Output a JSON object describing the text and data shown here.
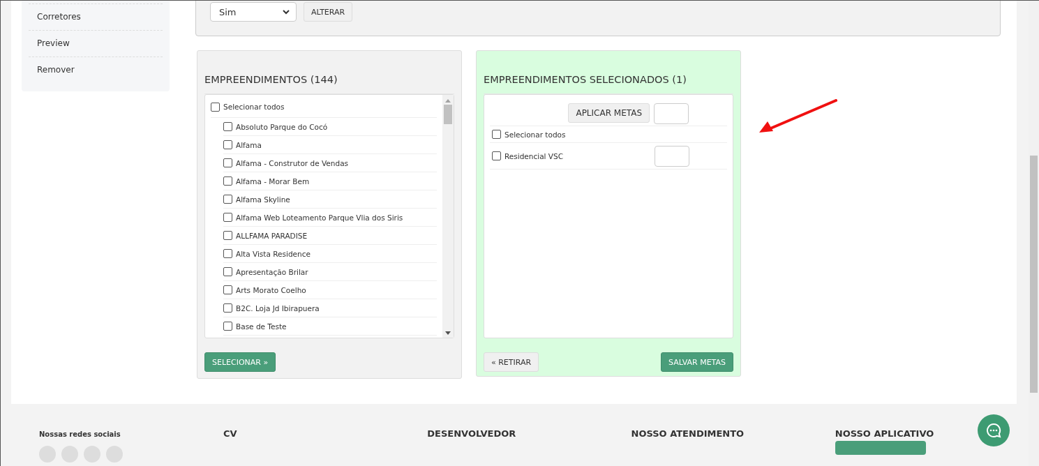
{
  "sidebar": {
    "items": [
      {
        "label": "Corretores"
      },
      {
        "label": "Preview"
      },
      {
        "label": "Remover"
      }
    ]
  },
  "top_panel": {
    "select": {
      "value": "Sim"
    },
    "button": "ALTERAR"
  },
  "available": {
    "title": "EMPREENDIMENTOS (144)",
    "select_all": {
      "label": "Selecionar todos",
      "checked": false
    },
    "items": [
      {
        "label": "Absoluto Parque do Cocó",
        "checked": false
      },
      {
        "label": "Alfama",
        "checked": false
      },
      {
        "label": "Alfama - Construtor de Vendas",
        "checked": false
      },
      {
        "label": "Alfama - Morar Bem",
        "checked": false
      },
      {
        "label": "Alfama Skyline",
        "checked": false
      },
      {
        "label": "Alfama Web Loteamento Parque Vlia dos Siris",
        "checked": false
      },
      {
        "label": "ALLFAMA PARADISE",
        "checked": false
      },
      {
        "label": "Alta Vista Residence",
        "checked": false
      },
      {
        "label": "Apresentação Brilar",
        "checked": false
      },
      {
        "label": "Arts Morato Coelho",
        "checked": false
      },
      {
        "label": "B2C. Loja Jd Ibirapuera",
        "checked": false
      },
      {
        "label": "Base de Teste",
        "checked": false
      }
    ],
    "button": "SELECIONAR »"
  },
  "selected": {
    "title": "EMPREENDIMENTOS SELECIONADOS (1)",
    "apply_button": "APLICAR METAS",
    "select_all": {
      "label": "Selecionar todos",
      "checked": false
    },
    "items": [
      {
        "label": "Residencial VSC",
        "checked": false
      }
    ],
    "remove_button": "« RETIRAR",
    "save_button": "SALVAR METAS"
  },
  "footer": {
    "columns": [
      "Nossas redes sociais",
      "CV",
      "DESENVOLVEDOR",
      "NOSSO ATENDIMENTO",
      "NOSSO APLICATIVO"
    ]
  }
}
